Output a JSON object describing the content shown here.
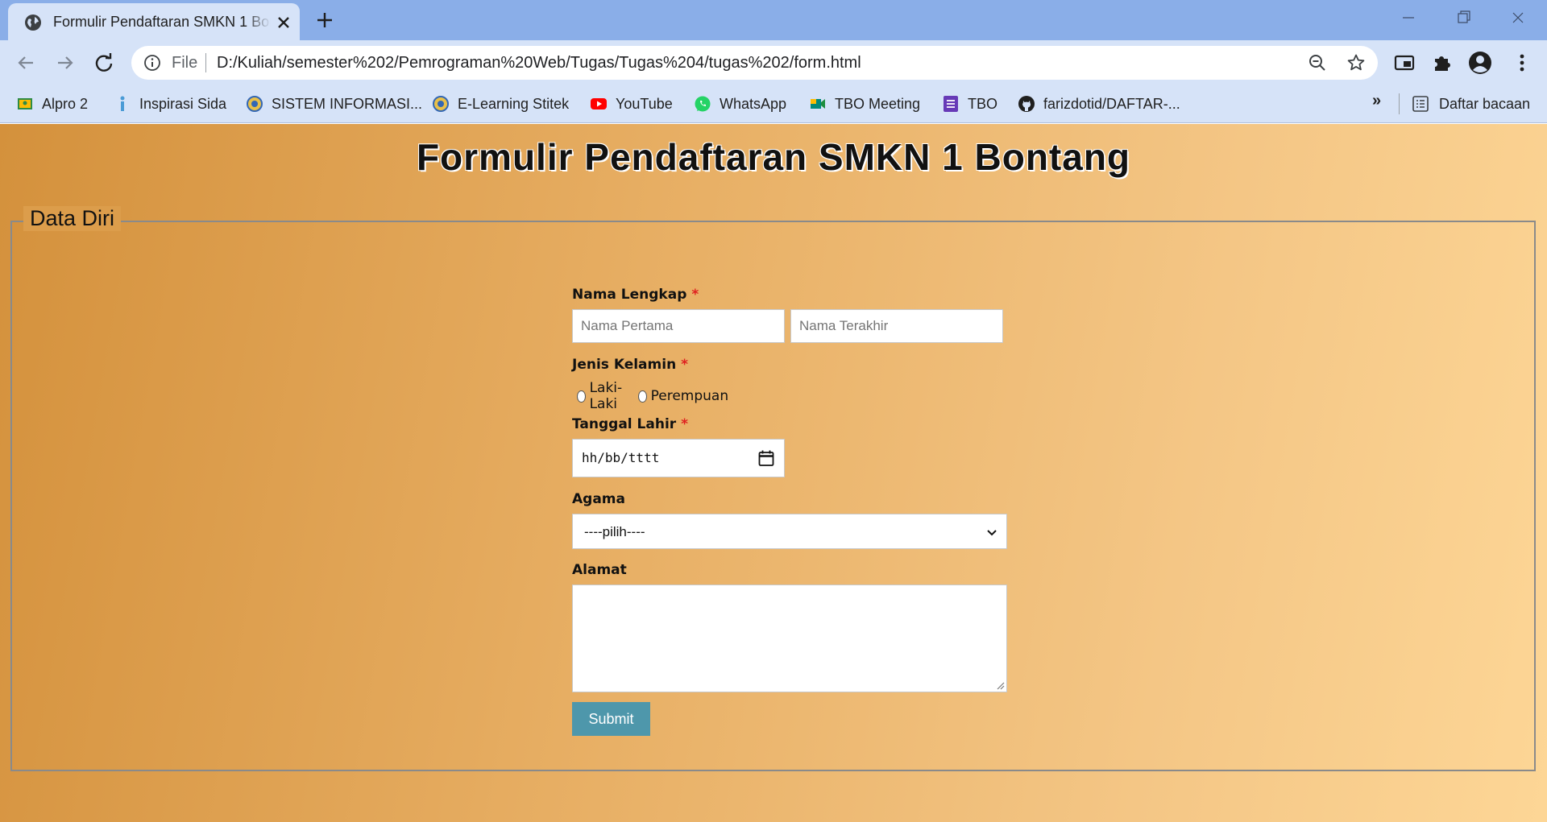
{
  "tab": {
    "title": "Formulir Pendaftaran SMKN 1 Bontang"
  },
  "address_bar": {
    "scheme": "File",
    "url": "D:/Kuliah/semester%202/Pemrograman%20Web/Tugas/Tugas%204/tugas%202/form.html"
  },
  "bookmarks": {
    "items": [
      {
        "label": "Alpro 2",
        "icon": "classroom-icon"
      },
      {
        "label": "Inspirasi Sida",
        "icon": "bookmark-icon"
      },
      {
        "label": "SISTEM INFORMASI...",
        "icon": "campus-icon"
      },
      {
        "label": "E-Learning Stitek",
        "icon": "campus-icon"
      },
      {
        "label": "YouTube",
        "icon": "youtube-icon"
      },
      {
        "label": "WhatsApp",
        "icon": "whatsapp-icon"
      },
      {
        "label": "TBO Meeting",
        "icon": "meet-icon"
      },
      {
        "label": "TBO",
        "icon": "forms-icon"
      },
      {
        "label": "farizdotid/DAFTAR-...",
        "icon": "github-icon"
      }
    ],
    "more": "»",
    "reading_list": "Daftar bacaan"
  },
  "page": {
    "title": "Formulir Pendaftaran SMKN 1 Bontang",
    "fieldset_legend": "Data Diri"
  },
  "form": {
    "name_label": "Nama Lengkap",
    "required_mark": "*",
    "first_name_placeholder": "Nama Pertama",
    "last_name_placeholder": "Nama Terakhir",
    "gender_label": "Jenis Kelamin",
    "gender_options": [
      "Laki-Laki",
      "Perempuan"
    ],
    "dob_label": "Tanggal Lahir",
    "dob_placeholder": "hh/bb/tttt",
    "religion_label": "Agama",
    "religion_selected": "----pilih----",
    "address_label": "Alamat",
    "submit_label": "Submit"
  },
  "colors": {
    "background_start": "#d4913c",
    "background_end": "#fdd696",
    "submit_button": "#4e97ab",
    "required": "#e02020"
  }
}
